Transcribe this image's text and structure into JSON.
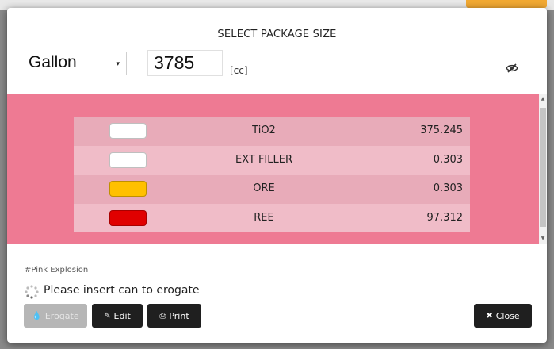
{
  "modal": {
    "title": "SELECT PACKAGE SIZE",
    "package": {
      "unit_selected": "Gallon",
      "size_value": "3785",
      "size_unit": "[cc]"
    },
    "formula_rows": [
      {
        "name": "TiO2",
        "value": "375.245",
        "color": "#ffffff"
      },
      {
        "name": "EXT FILLER",
        "value": "0.303",
        "color": "#ffffff"
      },
      {
        "name": "ORE",
        "value": "0.303",
        "color": "#ffc000"
      },
      {
        "name": "REE",
        "value": "97.312",
        "color": "#e00000"
      }
    ],
    "band_color": "#ee7a93",
    "color_tag": "#Pink Explosion",
    "status_text": "Please insert can to erogate",
    "buttons": {
      "erogate": "Erogate",
      "edit": "Edit",
      "print": "Print",
      "close": "Close"
    },
    "icons": {
      "visibility": "eye-slash-icon",
      "erogate": "tint-icon",
      "edit": "pencil-icon",
      "print": "print-icon",
      "close": "times-icon",
      "status": "spinner-icon"
    }
  }
}
